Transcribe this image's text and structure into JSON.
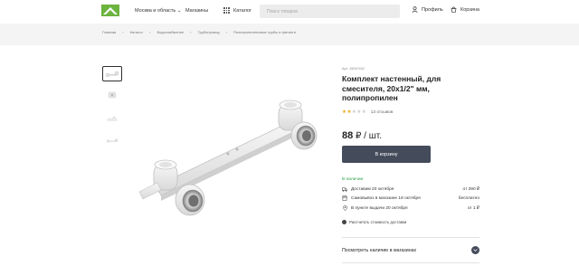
{
  "header": {
    "region": "Москва и область",
    "stores": "Магазины",
    "catalog": "Каталог",
    "search_placeholder": "Поиск товаров",
    "profile": "Профиль",
    "cart": "Корзина"
  },
  "breadcrumb": [
    "Главная",
    "Каталог",
    "Водоснабжение",
    "Трубопровод",
    "Полипропиленовые трубы и фитинги"
  ],
  "product": {
    "sku": "Арт. 15047452",
    "title": "Комплект настенный, для смесителя, 20х1/2\" мм, полипропилен",
    "rating_value": 2,
    "rating_max": 5,
    "reviews": "13 отзывов",
    "price_value": "88",
    "price_unit": "₽ / шт.",
    "buy_label": "В корзину",
    "in_stock": "В наличии",
    "delivery": [
      {
        "icon": "truck-icon",
        "label": "Доставим 20 октября",
        "value": "от 290 ₽"
      },
      {
        "icon": "store-icon",
        "label": "Самовывоз в магазине 18 октября",
        "value": "бесплатно"
      },
      {
        "icon": "pin-icon",
        "label": "В пункте выдачи 20 октября",
        "value": "от 1 ₽"
      }
    ],
    "calc_delivery": "Рассчитать стоимость доставки",
    "check_avail": "Посмотреть наличие в магазинах"
  },
  "colors": {
    "accent": "#444b5a",
    "in_stock": "#2ea24a",
    "brand_green": "#6cb33f"
  }
}
